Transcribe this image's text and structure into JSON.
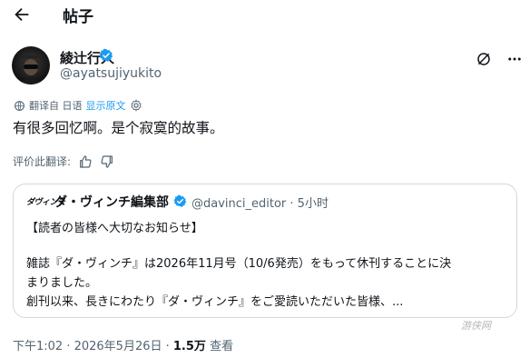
{
  "header": {
    "title": "帖子",
    "back_icon": "arrow-left-icon"
  },
  "author": {
    "name": "綾辻行人",
    "handle": "@ayatsujiyukito",
    "verified_color": "#1d9bf0"
  },
  "translation": {
    "label": "翻译自 日语",
    "show_original": "显示原文"
  },
  "tweet": {
    "text": "有很多回忆啊。是个寂寞的故事。"
  },
  "rating": {
    "label": "评价此翻译:"
  },
  "quote": {
    "logo": "ダヴィンチ",
    "name": "ダ・ヴィンチ編集部",
    "handle_time": "@davinci_editor · 5小时",
    "lines": [
      "【読者の皆様へ大切なお知らせ】",
      "雑誌『ダ・ヴィンチ』は2026年11月号（10/6発売）をもって休刊することに決",
      "まりました。",
      "創刊以来、長きにわたり『ダ・ヴィンチ』をご愛読いただいた皆様、..."
    ]
  },
  "footer": {
    "time_date": "下午1:02 · 2026年5月26日 · ",
    "views": "1.5万",
    "views_label": "查看"
  },
  "watermark": "游侠网"
}
